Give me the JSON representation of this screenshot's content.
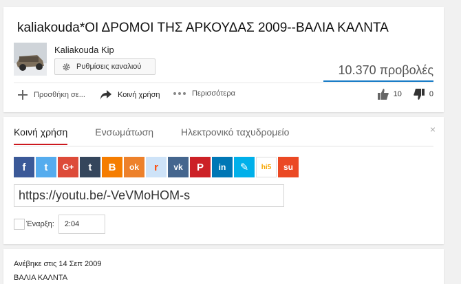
{
  "video": {
    "title": "kaliakouda*ΟΙ ΔΡΟΜΟΙ ΤΗΣ ΑΡΚΟΥΔΑΣ 2009--ΒΑΛΙΑ ΚΑΛΝΤΑ",
    "views": "10.370 προβολές",
    "likes": "10",
    "dislikes": "0"
  },
  "channel": {
    "name": "Kaliakouda Kip",
    "settings_label": "Ρυθμίσεις καναλιού"
  },
  "actions": {
    "add_to": "Προσθήκη σε...",
    "share": "Κοινή χρήση",
    "more": "Περισσότερα"
  },
  "share_panel": {
    "tabs": [
      "Κοινή χρήση",
      "Ενσωμάτωση",
      "Ηλεκτρονικό ταχυδρομείο"
    ],
    "close": "×",
    "url": "https://youtu.be/-VeVMoHOM-s",
    "start_label": "Έναρξη:",
    "start_value": "2:04",
    "icons": [
      {
        "name": "facebook-icon",
        "color": "#3b5998",
        "glyph": "f"
      },
      {
        "name": "twitter-icon",
        "color": "#55acee",
        "glyph": "t"
      },
      {
        "name": "googleplus-icon",
        "color": "#dd4b39",
        "glyph": "G+"
      },
      {
        "name": "tumblr-icon",
        "color": "#35465c",
        "glyph": "t"
      },
      {
        "name": "blogger-icon",
        "color": "#f57d00",
        "glyph": "B"
      },
      {
        "name": "odnoklassniki-icon",
        "color": "#ed812b",
        "glyph": "ok"
      },
      {
        "name": "reddit-icon",
        "color": "#cee3f8",
        "glyph": "r"
      },
      {
        "name": "vk-icon",
        "color": "#45668e",
        "glyph": "vk"
      },
      {
        "name": "pinterest-icon",
        "color": "#cc2127",
        "glyph": "P"
      },
      {
        "name": "linkedin-icon",
        "color": "#0077b5",
        "glyph": "in"
      },
      {
        "name": "livejournal-icon",
        "color": "#00b0ea",
        "glyph": "✎"
      },
      {
        "name": "hi5-icon",
        "color": "#fd9827",
        "glyph": "hi5"
      },
      {
        "name": "stumbleupon-icon",
        "color": "#eb4924",
        "glyph": "su"
      }
    ]
  },
  "description": {
    "published": "Ανέβηκε στις 14 Σεπ 2009",
    "text": "ΒΑΛΙΑ ΚΑΛΝΤΑ"
  },
  "colors": {
    "accent_blue": "#167ac6",
    "accent_red": "#cc181e"
  }
}
